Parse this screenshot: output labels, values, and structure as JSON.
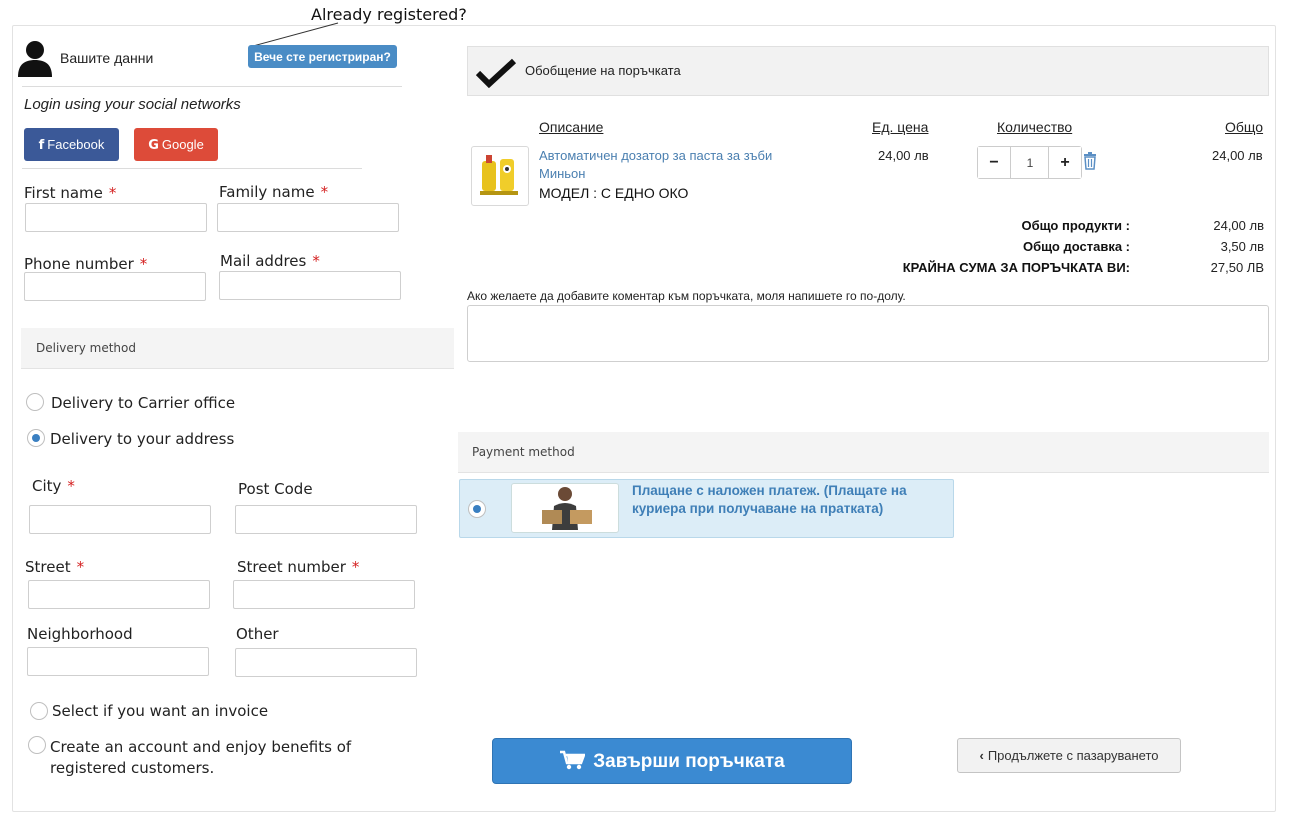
{
  "annotation": {
    "text": "Already registered?"
  },
  "customer": {
    "title": "Вашите данни",
    "registered_button": "Вече сте регистриран?",
    "social_title": "Login using your social networks",
    "facebook_label": "Facebook",
    "google_label": "Google",
    "required_mark": "*",
    "fields": {
      "first_name": "First name",
      "family_name": "Family name",
      "phone": "Phone number",
      "mail": "Mail addres"
    }
  },
  "delivery": {
    "title": "Delivery method",
    "options": [
      "Delivery to Carrier office",
      "Delivery to your address"
    ],
    "selected": 1,
    "fields": {
      "city": "City",
      "post_code": "Post Code",
      "street": "Street",
      "street_number": "Street number",
      "neighborhood": "Neighborhood",
      "other": "Other"
    },
    "invoice_label": "Select if you want an invoice",
    "account_label": "Create an account and enjoy benefits of registered customers."
  },
  "summary": {
    "title": "Обобщение на поръчката",
    "headers": {
      "description": "Описание",
      "unit_price": "Ед. цена",
      "quantity": "Количество",
      "total": "Общо"
    },
    "product": {
      "name": "Автоматичен дозатор за паста за зъби Миньон",
      "model": "МОДЕЛ : С ЕДНО ОКО",
      "unit_price": "24,00 лв",
      "quantity": "1",
      "total": "24,00 лв",
      "minus": "−",
      "plus": "+"
    },
    "totals": {
      "products_label": "Общо продукти :",
      "products_value": "24,00 лв",
      "shipping_label": "Общо доставка :",
      "shipping_value": "3,50 лв",
      "grand_label": "КРАЙНА СУМА ЗА ПОРЪЧКАТА ВИ:",
      "grand_value": "27,50 ЛВ"
    },
    "comment_label": "Ако желаете да добавите коментар към поръчката, моля напишете го по-долу."
  },
  "payment": {
    "title": "Payment method",
    "option_text": "Плащане с наложен платеж. (Плащате на куриера при получаване на пратката)"
  },
  "actions": {
    "finish": "Завърши поръчката",
    "continue": "Продължете с пазаруването"
  }
}
